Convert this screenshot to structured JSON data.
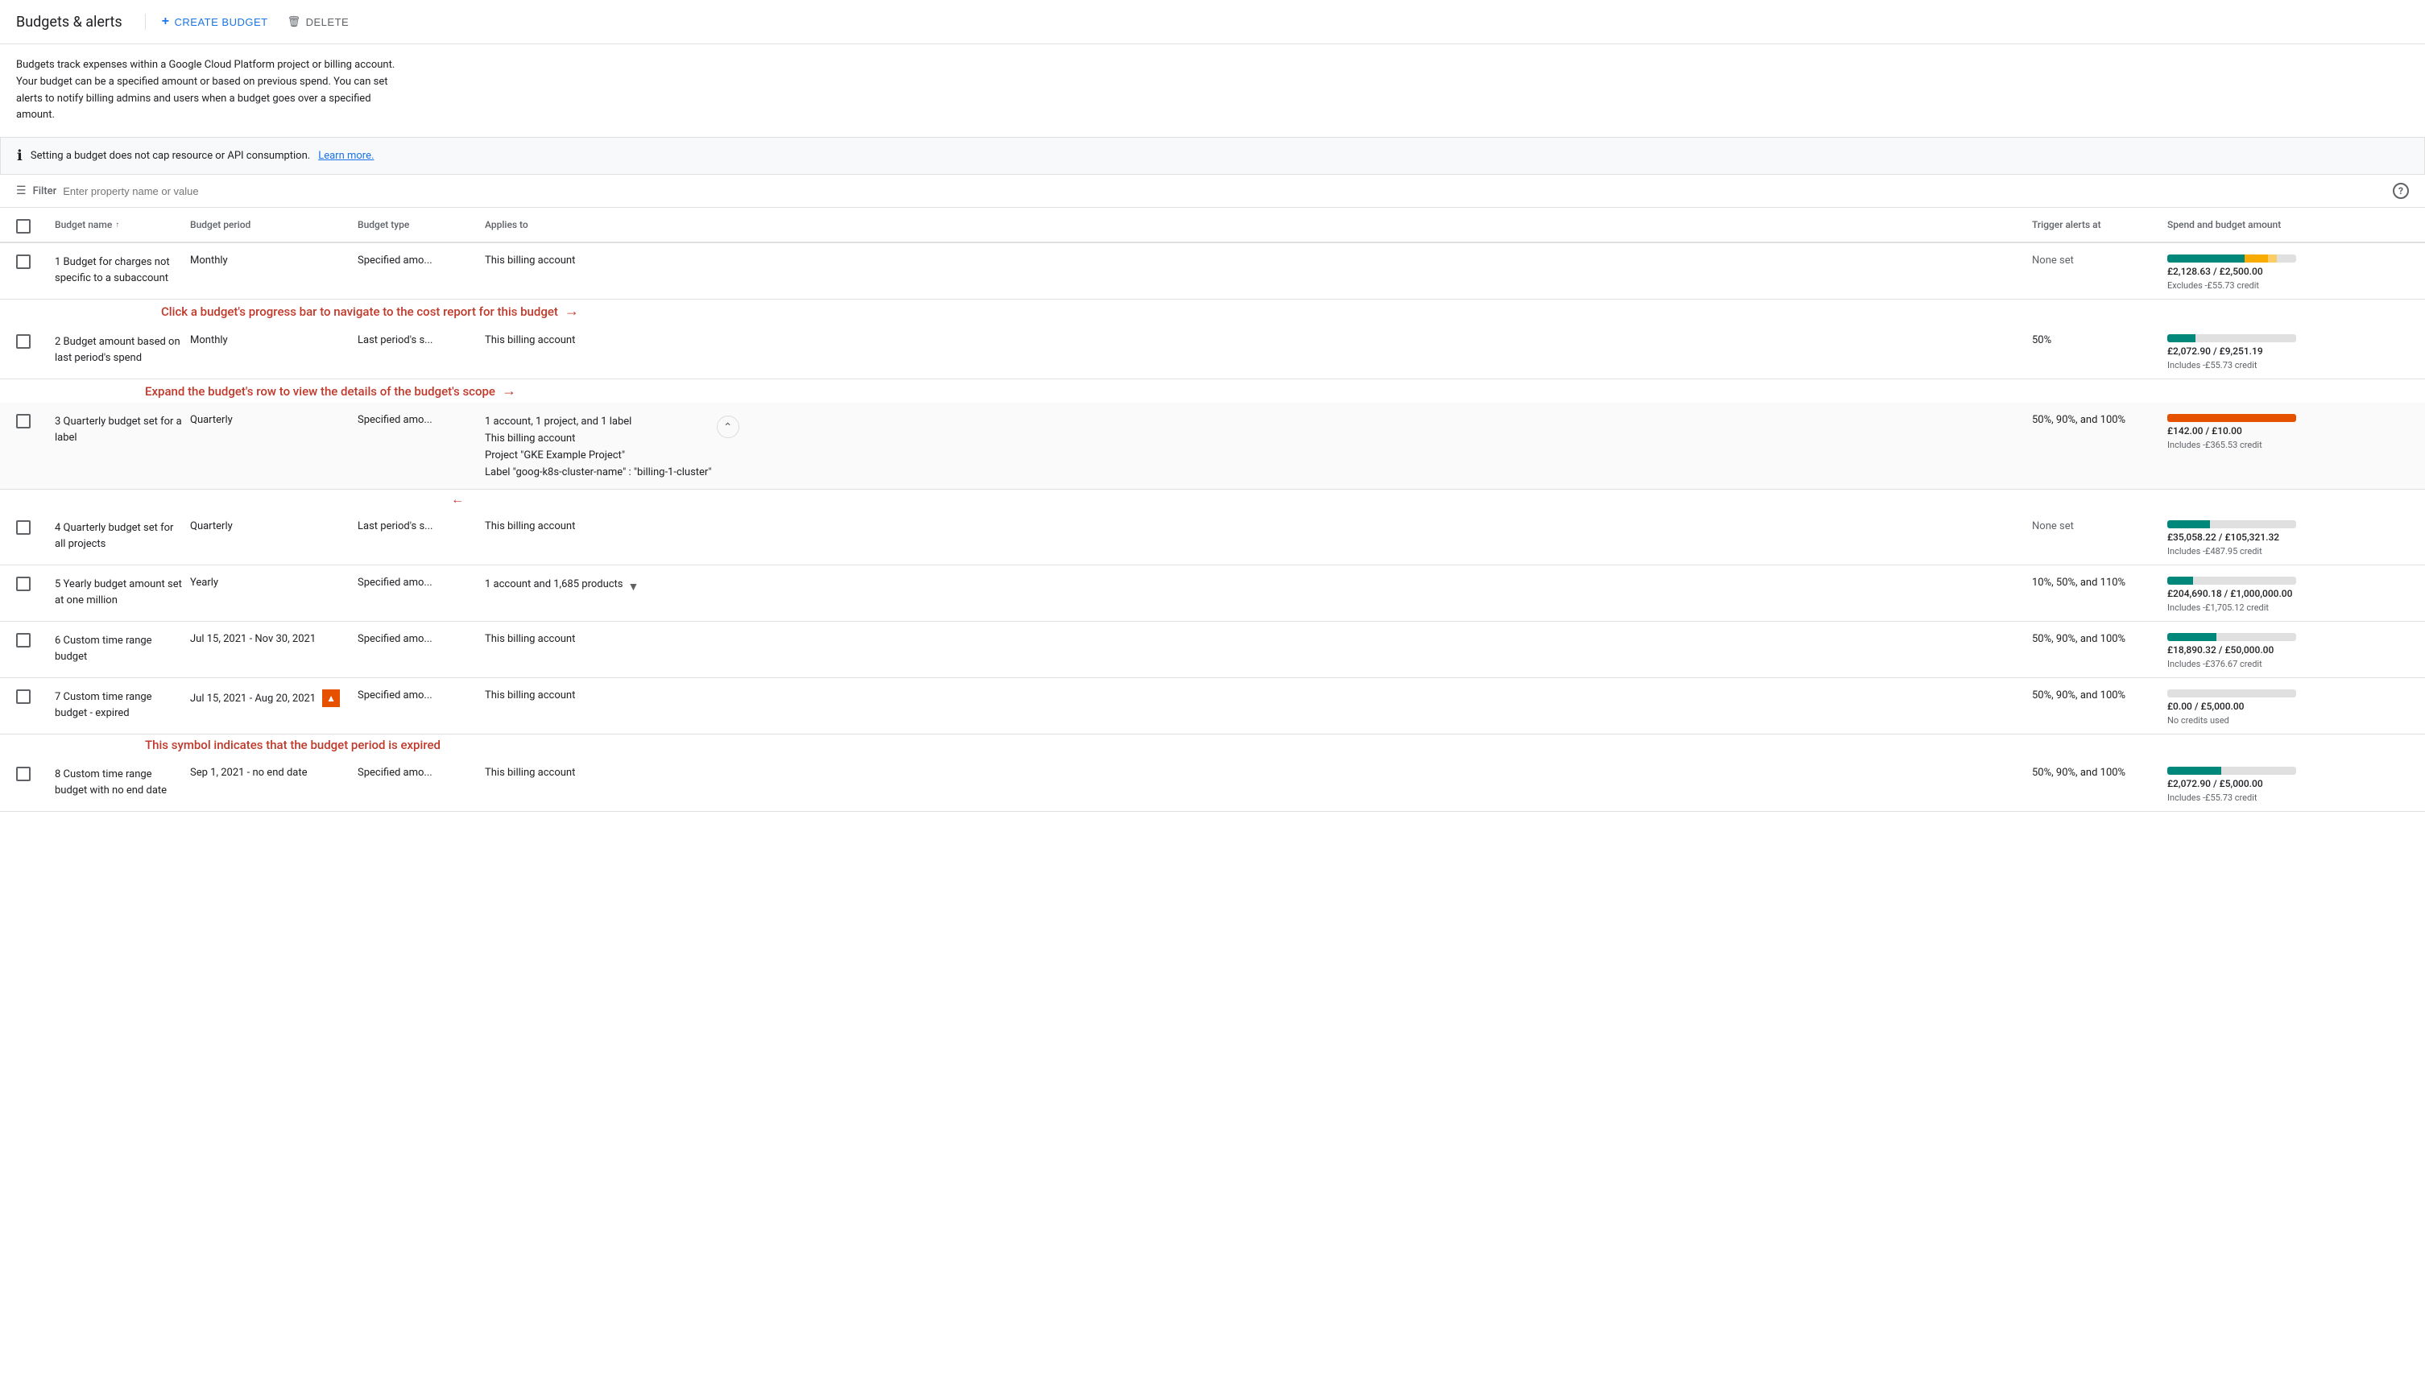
{
  "page": {
    "title": "Budgets & alerts",
    "buttons": {
      "create": "CREATE BUDGET",
      "delete": "DELETE"
    },
    "description": "Budgets track expenses within a Google Cloud Platform project or billing account. Your budget can be a specified amount or based on previous spend. You can set alerts to notify billing admins and users when a budget goes over a specified amount.",
    "info_banner": {
      "text": "Setting a budget does not cap resource or API consumption.",
      "learn_more": "Learn more."
    },
    "filter": {
      "placeholder": "Enter property name or value"
    },
    "table": {
      "headers": [
        "",
        "Budget name",
        "Budget period",
        "Budget type",
        "Applies to",
        "Trigger alerts at",
        "Spend and budget amount"
      ],
      "rows": [
        {
          "id": 1,
          "name": "1 Budget for charges not specific to a subaccount",
          "period": "Monthly",
          "type": "Specified amo...",
          "applies_to": "This billing account",
          "trigger": "None set",
          "spend": "£2,128.63 / £2,500.00",
          "spend_note": "Excludes -£55.73 credit",
          "bar_type": "multi_yellow",
          "annotation_bar": "Click a budget's progress bar to navigate to the cost report for this budget"
        },
        {
          "id": 2,
          "name": "2 Budget amount based on last period's spend",
          "period": "Monthly",
          "type": "Last period's s...",
          "applies_to": "This billing account",
          "trigger": "50%",
          "spend": "£2,072.90 / £9,251.19",
          "spend_note": "Includes -£55.73 credit",
          "bar_type": "teal_small",
          "annotation_expand": "Expand the budget's row to view the details of the budget's scope"
        },
        {
          "id": 3,
          "name": "3 Quarterly budget set for a label",
          "period": "Quarterly",
          "type": "Specified amo...",
          "applies_to_lines": [
            "1 account, 1 project, and 1 label",
            "This billing account",
            "Project \"GKE Example Project\"",
            "Label \"goog-k8s-cluster-name\" : \"billing-1-cluster\""
          ],
          "applies_to_expanded": true,
          "trigger": "50%, 90%, and 100%",
          "spend": "£142.00 / £10.00",
          "spend_note": "Includes -£365.53 credit",
          "bar_type": "orange_full"
        },
        {
          "id": 4,
          "name": "4 Quarterly budget set for all projects",
          "period": "Quarterly",
          "type": "Last period's s...",
          "applies_to": "This billing account",
          "trigger": "None set",
          "spend": "£35,058.22 / £105,321.32",
          "spend_note": "Includes -£487.95 credit",
          "bar_type": "teal_medium"
        },
        {
          "id": 5,
          "name": "5 Yearly budget amount set at one million",
          "period": "Yearly",
          "type": "Specified amo...",
          "applies_to": "1 account and 1,685 products",
          "has_expand": true,
          "trigger": "10%, 50%, and 110%",
          "spend": "£204,690.18 / £1,000,000.00",
          "spend_note": "Includes -£1,705.12 credit",
          "bar_type": "teal_small2"
        },
        {
          "id": 6,
          "name": "6 Custom time range budget",
          "period": "Jul 15, 2021 - Nov 30, 2021",
          "type": "Specified amo...",
          "applies_to": "This billing account",
          "trigger": "50%, 90%, and 100%",
          "spend": "£18,890.32 / £50,000.00",
          "spend_note": "Includes -£376.67 credit",
          "bar_type": "teal_small3"
        },
        {
          "id": 7,
          "name": "7 Custom time range budget - expired",
          "period": "Jul 15, 2021 - Aug 20, 2021",
          "period_expired": true,
          "type": "Specified amo...",
          "applies_to": "This billing account",
          "trigger": "50%, 90%, and 100%",
          "spend": "£0.00 / £5,000.00",
          "spend_note": "No credits used",
          "bar_type": "gray_empty",
          "annotation_expired": "This symbol indicates that the budget period is expired"
        },
        {
          "id": 8,
          "name": "8 Custom time range budget with no end date",
          "period": "Sep 1, 2021 - no end date",
          "type": "Specified amo...",
          "applies_to": "This billing account",
          "trigger": "50%, 90%, and 100%",
          "spend": "£2,072.90 / £5,000.00",
          "spend_note": "Includes -£55.73 credit",
          "bar_type": "teal_small4"
        }
      ]
    },
    "annotations": {
      "bar_annotation": "Click a budget's progress bar to navigate to the cost report for this budget",
      "expand_annotation": "Expand the budget's row to view the details of the budget's scope",
      "expired_annotation": "This symbol indicates that the budget period is expired"
    }
  }
}
